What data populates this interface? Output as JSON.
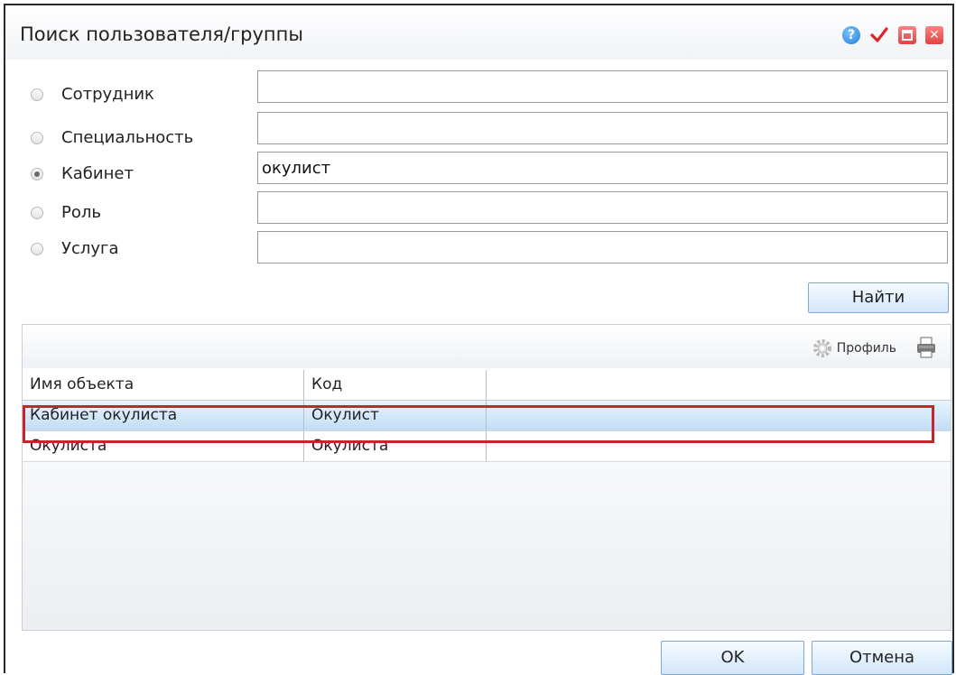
{
  "dialog": {
    "title": "Поиск пользователя/группы",
    "icons": [
      "help-icon",
      "check-icon",
      "minimize-icon",
      "close-icon"
    ]
  },
  "search": {
    "options": [
      {
        "label": "Сотрудник",
        "checked": false,
        "value": ""
      },
      {
        "label": "Специальность",
        "checked": false,
        "value": ""
      },
      {
        "label": "Кабинет",
        "checked": true,
        "value": "окулист"
      },
      {
        "label": "Роль",
        "checked": false,
        "value": ""
      },
      {
        "label": "Услуга",
        "checked": false,
        "value": ""
      }
    ],
    "find_label": "Найти"
  },
  "grid": {
    "toolbar": {
      "profile_label": "Профиль"
    },
    "columns": [
      "Имя объекта",
      "Код",
      ""
    ],
    "rows": [
      {
        "name": "Кабинет окулиста",
        "code": "Окулист",
        "selected": true
      },
      {
        "name": "Окулиста",
        "code": "Окулиста",
        "selected": false
      }
    ]
  },
  "footer": {
    "ok_label": "OK",
    "cancel_label": "Отмена"
  },
  "colors": {
    "accent": "#1f7fd8",
    "highlight": "#c6262b",
    "selection": "#bfdcf5"
  }
}
